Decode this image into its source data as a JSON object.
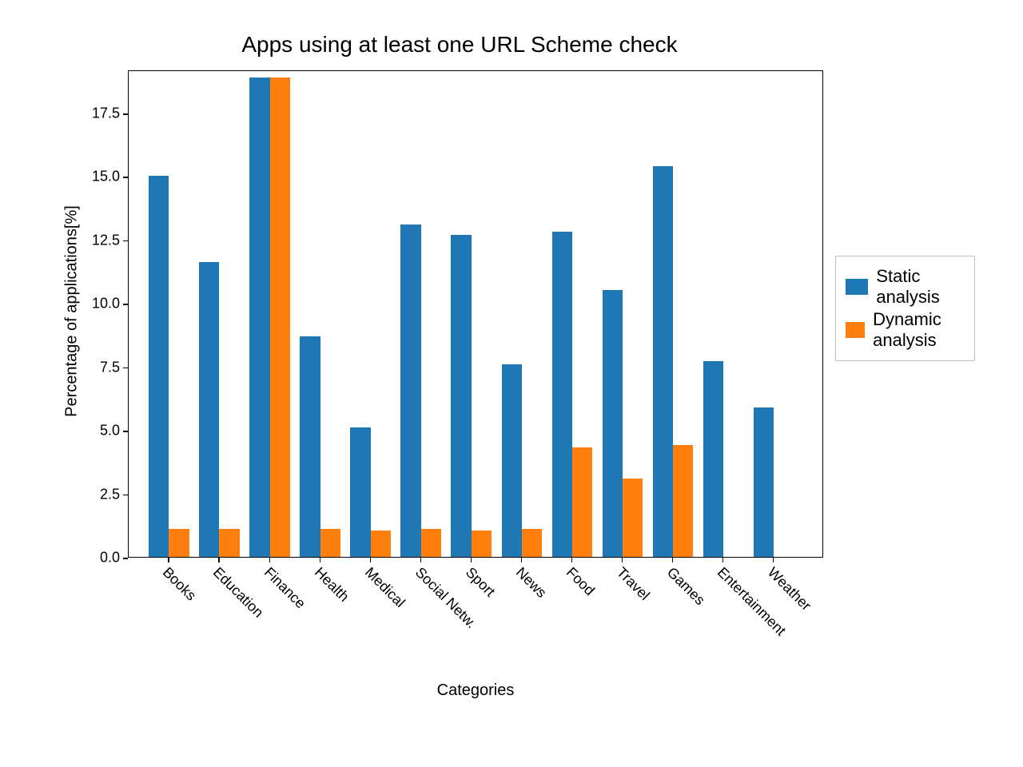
{
  "chart_data": {
    "type": "bar",
    "title": "Apps using at least one URL Scheme check",
    "xlabel": "Categories",
    "ylabel": "Percentage of applications[%]",
    "categories": [
      "Books",
      "Education",
      "Finance",
      "Health",
      "Medical",
      "Social Netw.",
      "Sport",
      "News",
      "Food",
      "Travel",
      "Games",
      "Entertainment",
      "Weather"
    ],
    "series": [
      {
        "name": "Static analysis",
        "values": [
          15.0,
          11.6,
          18.9,
          8.7,
          5.1,
          13.1,
          12.7,
          7.6,
          12.8,
          10.5,
          15.4,
          7.7,
          5.9
        ],
        "color": "#1f77b4"
      },
      {
        "name": "Dynamic analysis",
        "values": [
          1.1,
          1.1,
          18.9,
          1.1,
          1.05,
          1.1,
          1.05,
          1.1,
          4.3,
          3.1,
          4.4,
          0,
          0
        ],
        "color": "#ff7f0e"
      }
    ],
    "ylim": [
      0,
      19.2
    ],
    "yticks": [
      0.0,
      2.5,
      5.0,
      7.5,
      10.0,
      12.5,
      15.0,
      17.5
    ],
    "ytick_labels": [
      "0.0",
      "2.5",
      "5.0",
      "7.5",
      "10.0",
      "12.5",
      "15.0",
      "17.5"
    ]
  }
}
